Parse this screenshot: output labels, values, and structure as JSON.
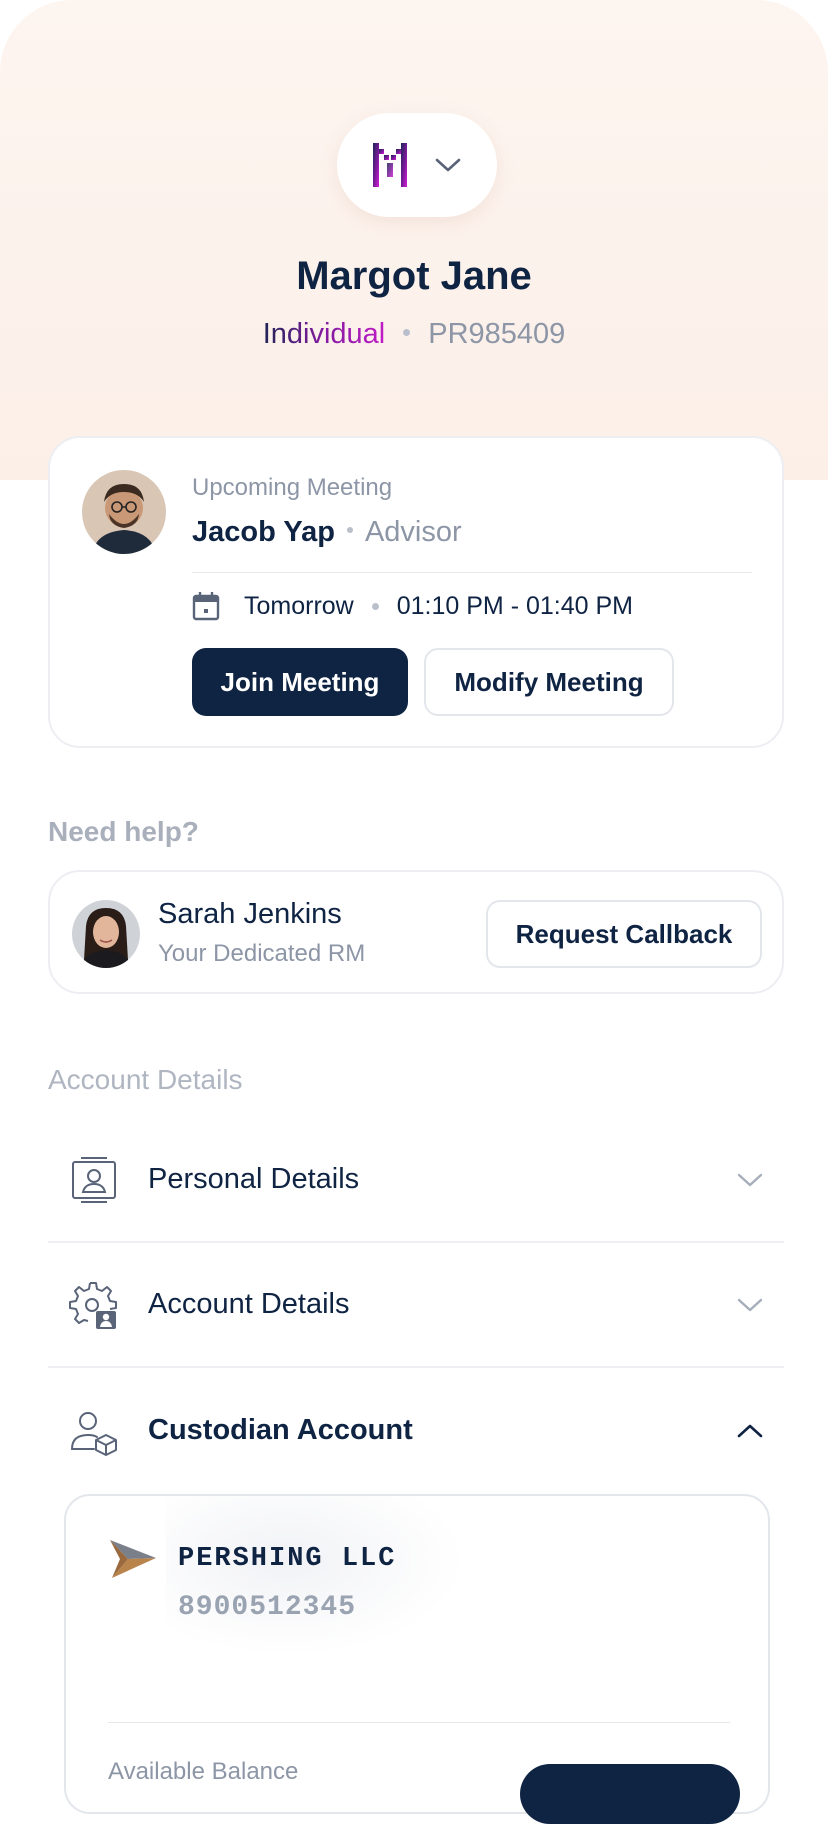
{
  "profile": {
    "name": "Margot Jane",
    "type": "Individual",
    "id": "PR985409"
  },
  "meeting": {
    "label": "Upcoming Meeting",
    "person": "Jacob Yap",
    "role": "Advisor",
    "day": "Tomorrow",
    "time": "01:10 PM - 01:40 PM",
    "join_label": "Join Meeting",
    "modify_label": "Modify Meeting"
  },
  "help": {
    "title": "Need help?",
    "name": "Sarah Jenkins",
    "role": "Your Dedicated RM",
    "callback_label": "Request Callback"
  },
  "account": {
    "title": "Account Details",
    "rows": [
      {
        "label": "Personal Details",
        "icon": "id-card-icon",
        "expanded": false
      },
      {
        "label": "Account Details",
        "icon": "gear-user-icon",
        "expanded": false
      },
      {
        "label": "Custodian Account",
        "icon": "user-box-icon",
        "expanded": true
      }
    ]
  },
  "custodian": {
    "name": "PERSHING LLC",
    "number": "8900512345",
    "balance_label": "Available Balance"
  },
  "colors": {
    "navy": "#0f2343",
    "muted": "#8d96a6",
    "brand_purple": "#c01cc7"
  }
}
